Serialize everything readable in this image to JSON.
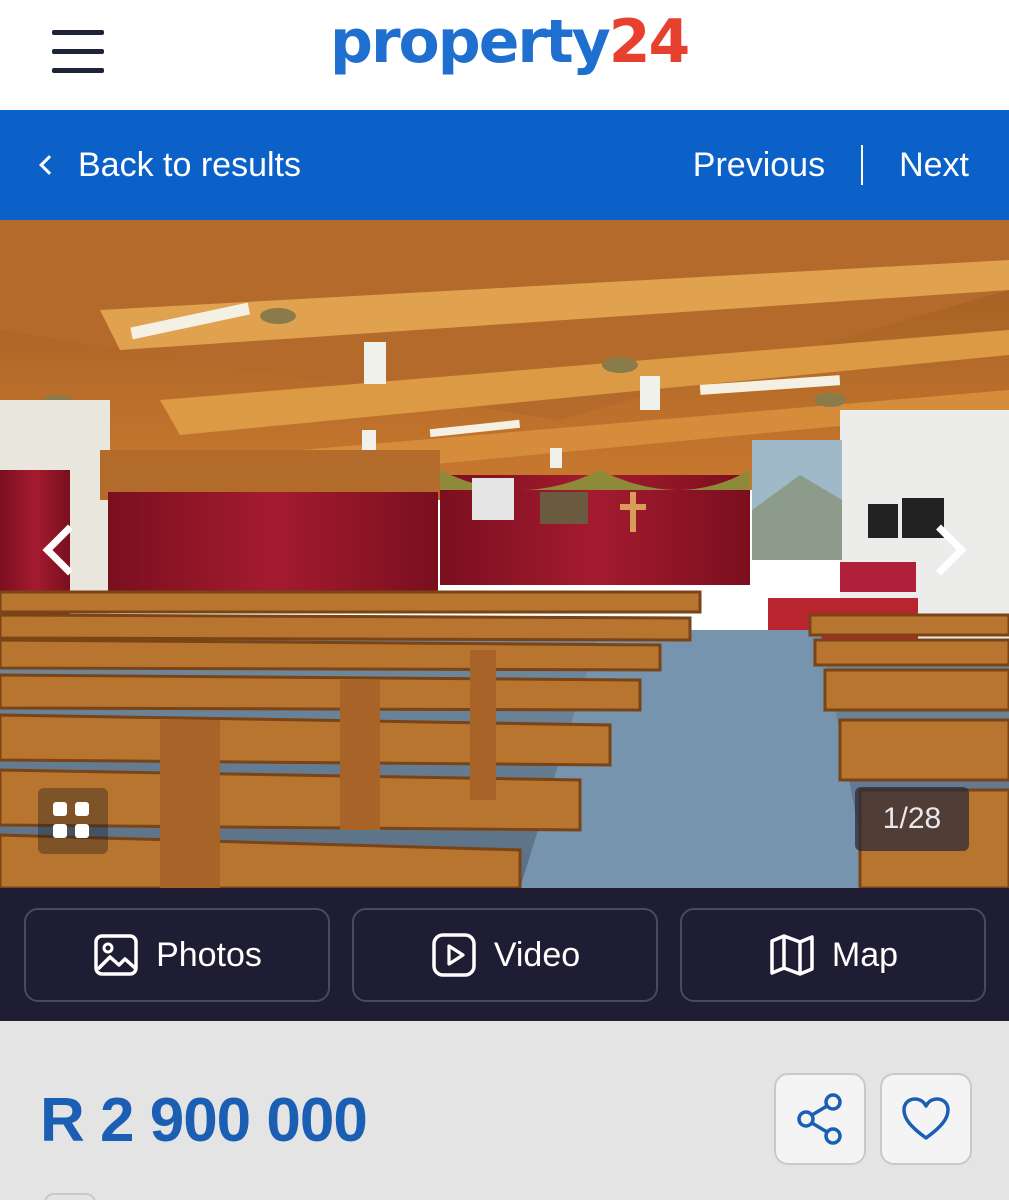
{
  "header": {
    "logo_text_part1": "property",
    "logo_text_part2": "24",
    "menu_icon": "hamburger-menu-icon"
  },
  "nav": {
    "back_label": "Back to results",
    "previous_label": "Previous",
    "next_label": "Next"
  },
  "gallery": {
    "counter": "1/28",
    "prev_icon": "chevron-left-icon",
    "next_icon": "chevron-right-icon",
    "grid_icon": "grid-icon"
  },
  "media_buttons": [
    {
      "label": "Photos",
      "icon": "image-icon"
    },
    {
      "label": "Video",
      "icon": "play-icon"
    },
    {
      "label": "Map",
      "icon": "map-icon"
    }
  ],
  "listing": {
    "price": "R 2 900 000",
    "share_icon": "share-icon",
    "favourite_icon": "heart-icon"
  },
  "colors": {
    "brand_blue": "#1f6fd0",
    "brand_red": "#e8402f",
    "nav_blue": "#0b61c8",
    "media_bar": "#1f1d33",
    "price_blue": "#1b5fb4"
  }
}
